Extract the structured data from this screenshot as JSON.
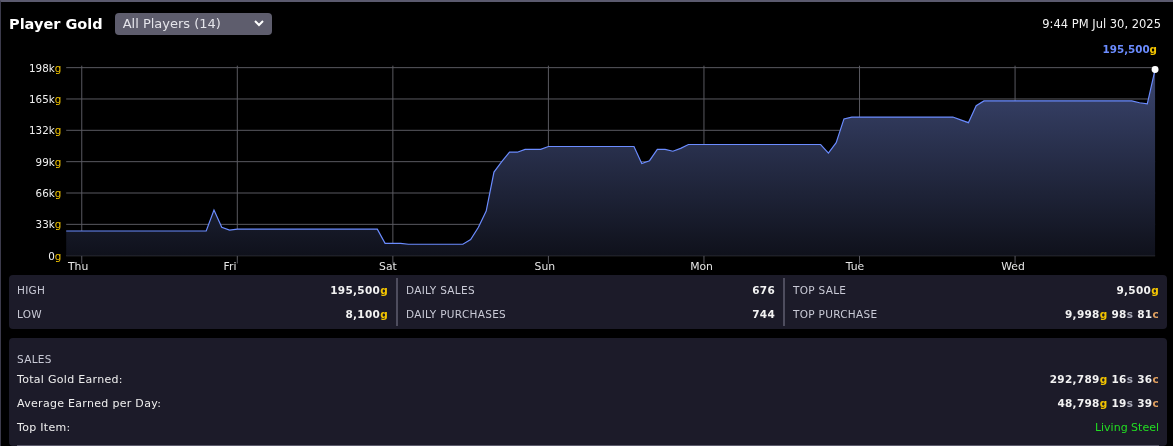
{
  "header": {
    "title": "Player Gold",
    "filter": {
      "value": "All Players (14)"
    },
    "timestamp": "9:44 PM Jul 30, 2025"
  },
  "chart": {
    "current": {
      "parts": [
        {
          "amount": "195,500",
          "unit": "g",
          "kind": "gold"
        }
      ]
    },
    "chart_data": {
      "type": "area",
      "grid": true,
      "ylim": [
        0,
        198
      ],
      "categories": [
        null,
        null,
        "Thu",
        null,
        null,
        null,
        null,
        null,
        null,
        null,
        null,
        null,
        null,
        null,
        null,
        null,
        null,
        null,
        null,
        null,
        null,
        null,
        "Fri",
        null,
        null,
        null,
        null,
        null,
        null,
        null,
        null,
        null,
        null,
        null,
        null,
        null,
        null,
        null,
        null,
        null,
        null,
        null,
        "Sat",
        null,
        null,
        null,
        null,
        null,
        null,
        null,
        null,
        null,
        null,
        null,
        null,
        null,
        null,
        null,
        null,
        null,
        null,
        null,
        "Sun",
        null,
        null,
        null,
        null,
        null,
        null,
        null,
        null,
        null,
        null,
        null,
        null,
        null,
        null,
        null,
        null,
        null,
        null,
        null,
        "Mon",
        null,
        null,
        null,
        null,
        null,
        null,
        null,
        null,
        null,
        null,
        null,
        null,
        null,
        null,
        null,
        null,
        null,
        null,
        null,
        "Tue",
        null,
        null,
        null,
        null,
        null,
        null,
        null,
        null,
        null,
        null,
        null,
        null,
        null,
        null,
        null,
        null,
        null,
        null,
        null,
        "Wed",
        null,
        null,
        null,
        null,
        null,
        null,
        null,
        null,
        null,
        null,
        null,
        null,
        null,
        null,
        null,
        null,
        null,
        null
      ],
      "yticks": [
        {
          "value": 0,
          "label": "0g"
        },
        {
          "value": 33,
          "label": "33kg"
        },
        {
          "value": 66,
          "label": "66kg"
        },
        {
          "value": 99,
          "label": "99kg"
        },
        {
          "value": 132,
          "label": "132kg"
        },
        {
          "value": 165,
          "label": "165kg"
        },
        {
          "value": 198,
          "label": "198kg"
        }
      ],
      "series": [
        {
          "color": "#6b8cff",
          "values": [
            26,
            26,
            26,
            26,
            26,
            26,
            26,
            26,
            26,
            26,
            26,
            26,
            26,
            26,
            26,
            26,
            26,
            26,
            26,
            48,
            30,
            27,
            28,
            28,
            28,
            28,
            28,
            28,
            28,
            28,
            28,
            28,
            28,
            28,
            28,
            28,
            28,
            28,
            28,
            28,
            28,
            13,
            13,
            13,
            12,
            12,
            12,
            12,
            12,
            12,
            12,
            12,
            17,
            30,
            47,
            88,
            99,
            109,
            109,
            112,
            112,
            112,
            115,
            115,
            115,
            115,
            115,
            115,
            115,
            115,
            115,
            115,
            115,
            115,
            97,
            100,
            112,
            112,
            110,
            113,
            117,
            117,
            117,
            117,
            117,
            117,
            117,
            117,
            117,
            117,
            117,
            117,
            117,
            117,
            117,
            117,
            117,
            117,
            108,
            119,
            144,
            146,
            146,
            146,
            146,
            146,
            146,
            146,
            146,
            146,
            146,
            146,
            146,
            146,
            146,
            143,
            140,
            158,
            163,
            163,
            163,
            163,
            163,
            163,
            163,
            163,
            163,
            163,
            163,
            163,
            163,
            163,
            163,
            163,
            163,
            163,
            163,
            163,
            161,
            160,
            196
          ]
        }
      ]
    }
  },
  "stats": [
    {
      "rows": [
        {
          "label": "HIGH",
          "parts": [
            {
              "amount": "195,500",
              "unit": "g",
              "kind": "gold"
            }
          ]
        },
        {
          "label": "LOW",
          "parts": [
            {
              "amount": "8,100",
              "unit": "g",
              "kind": "gold"
            }
          ]
        }
      ]
    },
    {
      "rows": [
        {
          "label": "DAILY SALES",
          "parts": [
            {
              "amount": "676"
            }
          ]
        },
        {
          "label": "DAILY PURCHASES",
          "parts": [
            {
              "amount": "744"
            }
          ]
        }
      ]
    },
    {
      "rows": [
        {
          "label": "TOP SALE",
          "parts": [
            {
              "amount": "9,500",
              "unit": "g",
              "kind": "gold"
            }
          ]
        },
        {
          "label": "TOP PURCHASE",
          "parts": [
            {
              "amount": "9,998",
              "unit": "g",
              "kind": "gold"
            },
            {
              "amount": "98",
              "unit": "s",
              "kind": "silver"
            },
            {
              "amount": "81",
              "unit": "c",
              "kind": "copper"
            }
          ]
        }
      ]
    }
  ],
  "sales": {
    "title": "SALES",
    "rows": [
      {
        "kind": "money",
        "label": "Total Gold Earned:",
        "parts": [
          {
            "amount": "292,789",
            "unit": "g",
            "kind": "gold"
          },
          {
            "amount": "16",
            "unit": "s",
            "kind": "silver"
          },
          {
            "amount": "36",
            "unit": "c",
            "kind": "copper"
          }
        ]
      },
      {
        "kind": "money",
        "label": "Average Earned per Day:",
        "parts": [
          {
            "amount": "48,798",
            "unit": "g",
            "kind": "gold"
          },
          {
            "amount": "19",
            "unit": "s",
            "kind": "silver"
          },
          {
            "amount": "39",
            "unit": "c",
            "kind": "copper"
          }
        ]
      },
      {
        "kind": "item",
        "label": "Top Item:",
        "value": "Living Steel"
      }
    ]
  }
}
